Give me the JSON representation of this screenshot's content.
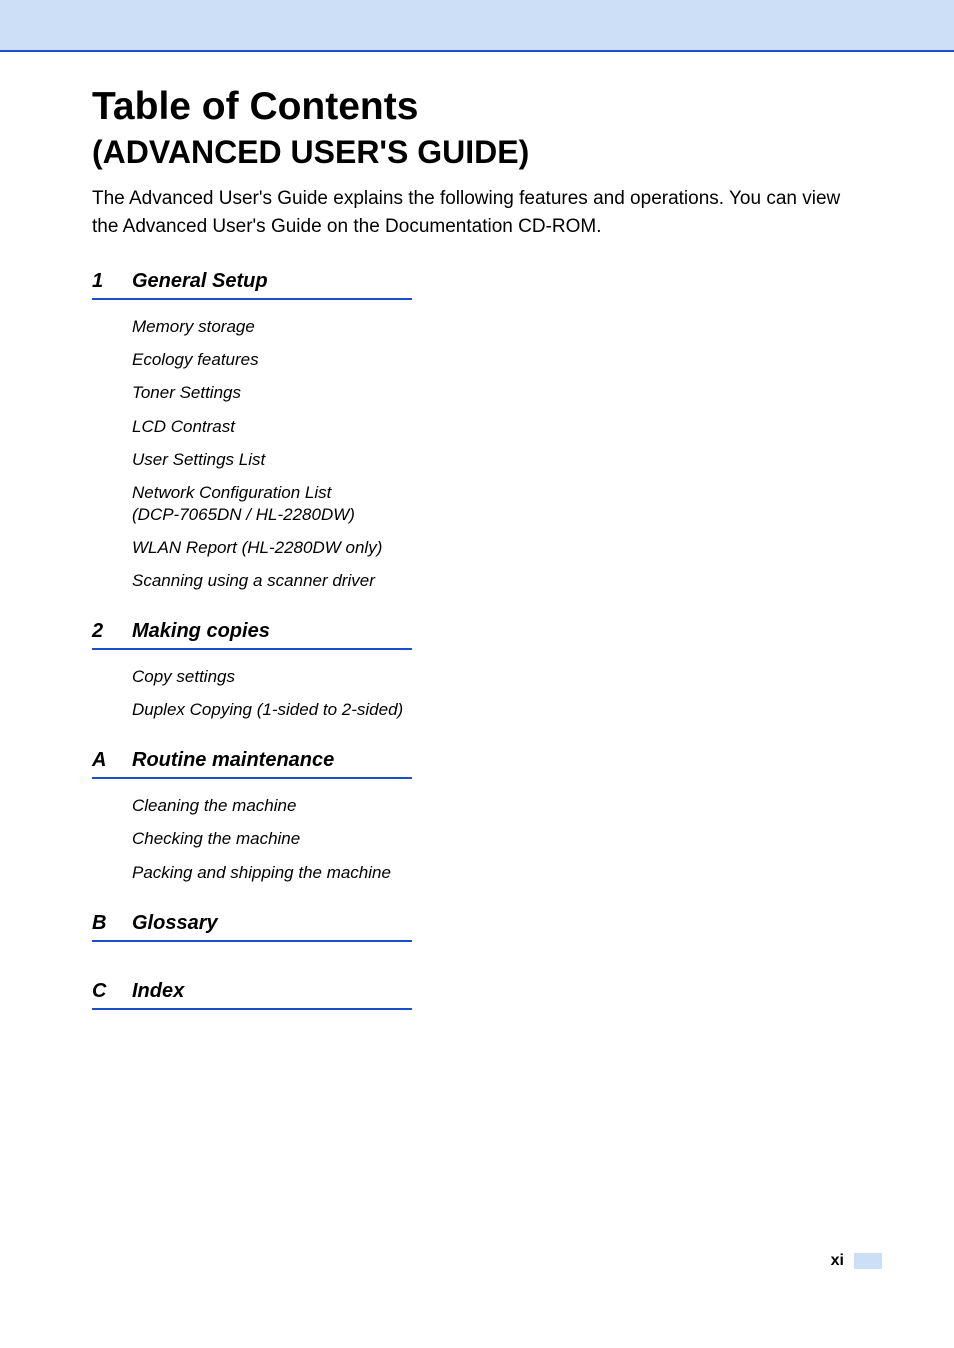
{
  "header": {
    "title": "Table of Contents",
    "subtitle": "(ADVANCED USER'S GUIDE)",
    "intro": "The Advanced User's Guide explains the following features and operations. You can view the Advanced User's Guide on the Documentation CD-ROM."
  },
  "sections": [
    {
      "num": "1",
      "title": "General Setup",
      "items": [
        "Memory storage",
        "Ecology features",
        "Toner Settings",
        "LCD Contrast",
        "User Settings List",
        "Network Configuration List\n(DCP-7065DN / HL-2280DW)",
        "WLAN Report (HL-2280DW only)",
        "Scanning using a scanner driver"
      ]
    },
    {
      "num": "2",
      "title": "Making copies",
      "items": [
        "Copy settings",
        "Duplex Copying (1-sided to 2-sided)"
      ]
    },
    {
      "num": "A",
      "title": "Routine maintenance",
      "items": [
        "Cleaning the machine",
        "Checking the machine",
        "Packing and shipping the machine"
      ]
    },
    {
      "num": "B",
      "title": "Glossary",
      "items": []
    },
    {
      "num": "C",
      "title": "Index",
      "items": []
    }
  ],
  "footer": {
    "page_number": "xi"
  }
}
